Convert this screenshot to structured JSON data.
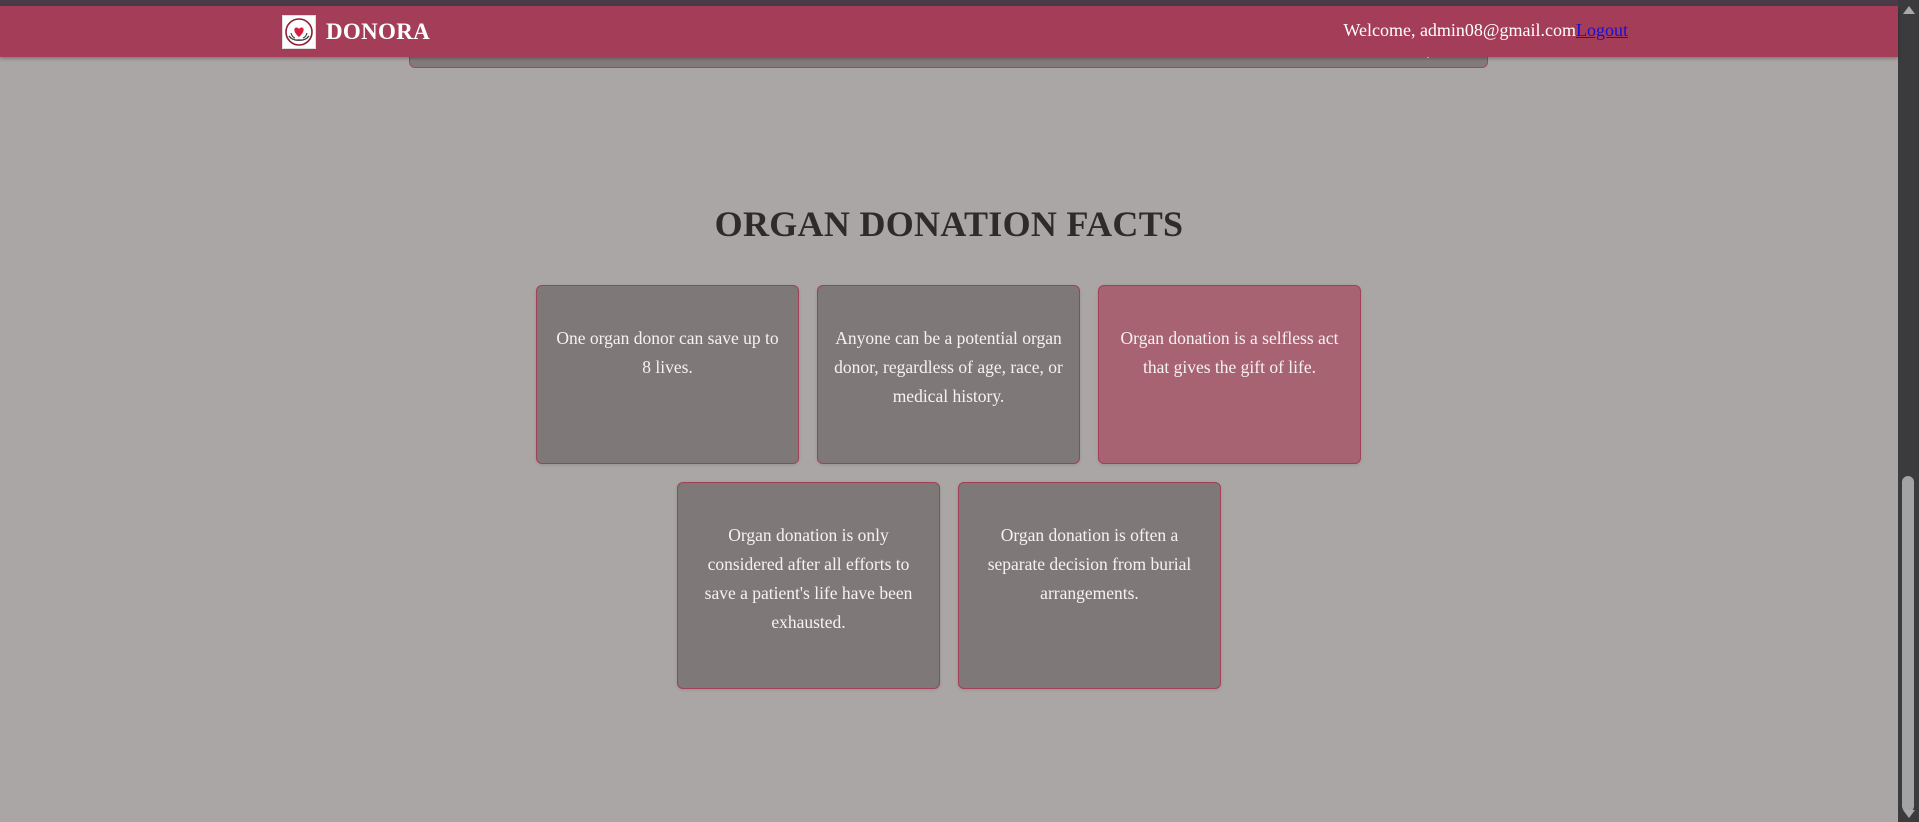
{
  "header": {
    "brand": "DONORA",
    "welcome_text": "Welcome, admin08@gmail.com",
    "logout_label": "Logout",
    "icons": {
      "logo": "heart-hands-logo-icon"
    }
  },
  "facts": {
    "title": "ORGAN DONATION FACTS",
    "items": [
      {
        "text": "One organ donor can save up to 8 lives."
      },
      {
        "text": "Anyone can be a potential organ donor, regardless of age, race, or medical history."
      },
      {
        "text": "Organ donation is a selfless act that gives the gift of life."
      },
      {
        "text": "Organ donation is only considered after all efforts to save a patient's life have been exhausted."
      },
      {
        "text": "Organ donation is often a separate decision from burial arrangements."
      }
    ]
  },
  "colors": {
    "navbar": "#a43d57",
    "page_background": "#aaa6a5",
    "card_background": "#7f7878",
    "card_highlight": "#a86373",
    "card_border": "#a24058",
    "title_text": "#2f2b2b",
    "logout_link": "#1a0dd6"
  }
}
